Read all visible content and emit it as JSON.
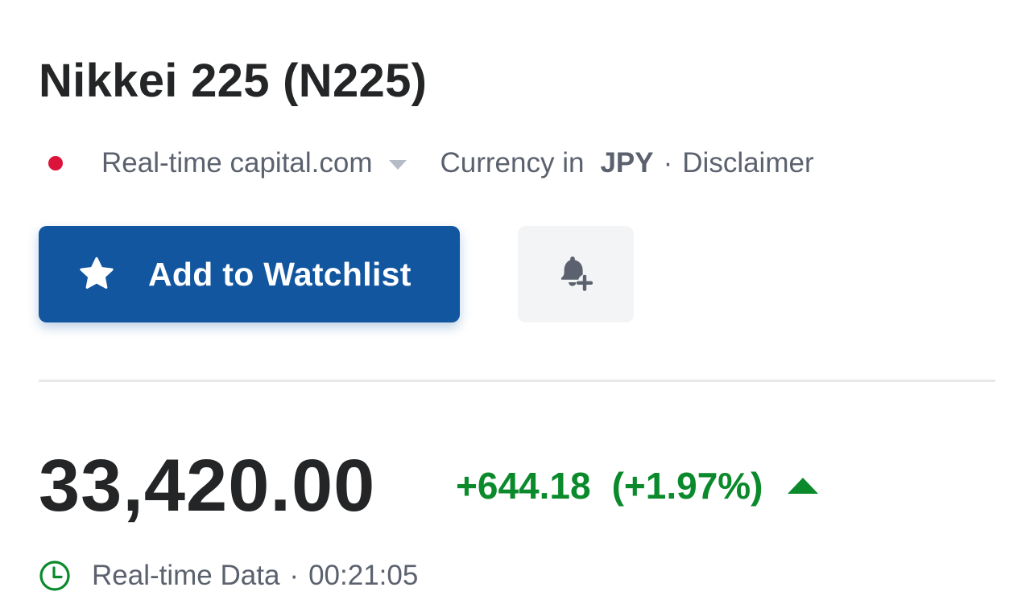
{
  "instrument": {
    "title": "Nikkei 225 (N225)"
  },
  "meta": {
    "source": "Real-time capital.com",
    "currency_prefix": "Currency in",
    "currency_code": "JPY",
    "separator": "·",
    "disclaimer": "Disclaimer"
  },
  "actions": {
    "watchlist_label": "Add to Watchlist"
  },
  "quote": {
    "price": "33,420.00",
    "change": "+644.18",
    "change_percent": "(+1.97%)",
    "direction": "up"
  },
  "status": {
    "label": "Real-time Data",
    "separator": "·",
    "time": "00:21:05"
  },
  "icons": {
    "live": "red-dot-icon",
    "source_dropdown": "chevron-down-icon",
    "watchlist": "star-icon",
    "alert": "bell-plus-icon",
    "trend": "triangle-up-icon",
    "status": "clock-icon"
  },
  "colors": {
    "brand_blue": "#1256a0",
    "positive_green": "#0b8a2c",
    "live_red": "#dc143c",
    "text_dark": "#232526",
    "text_muted": "#5b616e"
  }
}
